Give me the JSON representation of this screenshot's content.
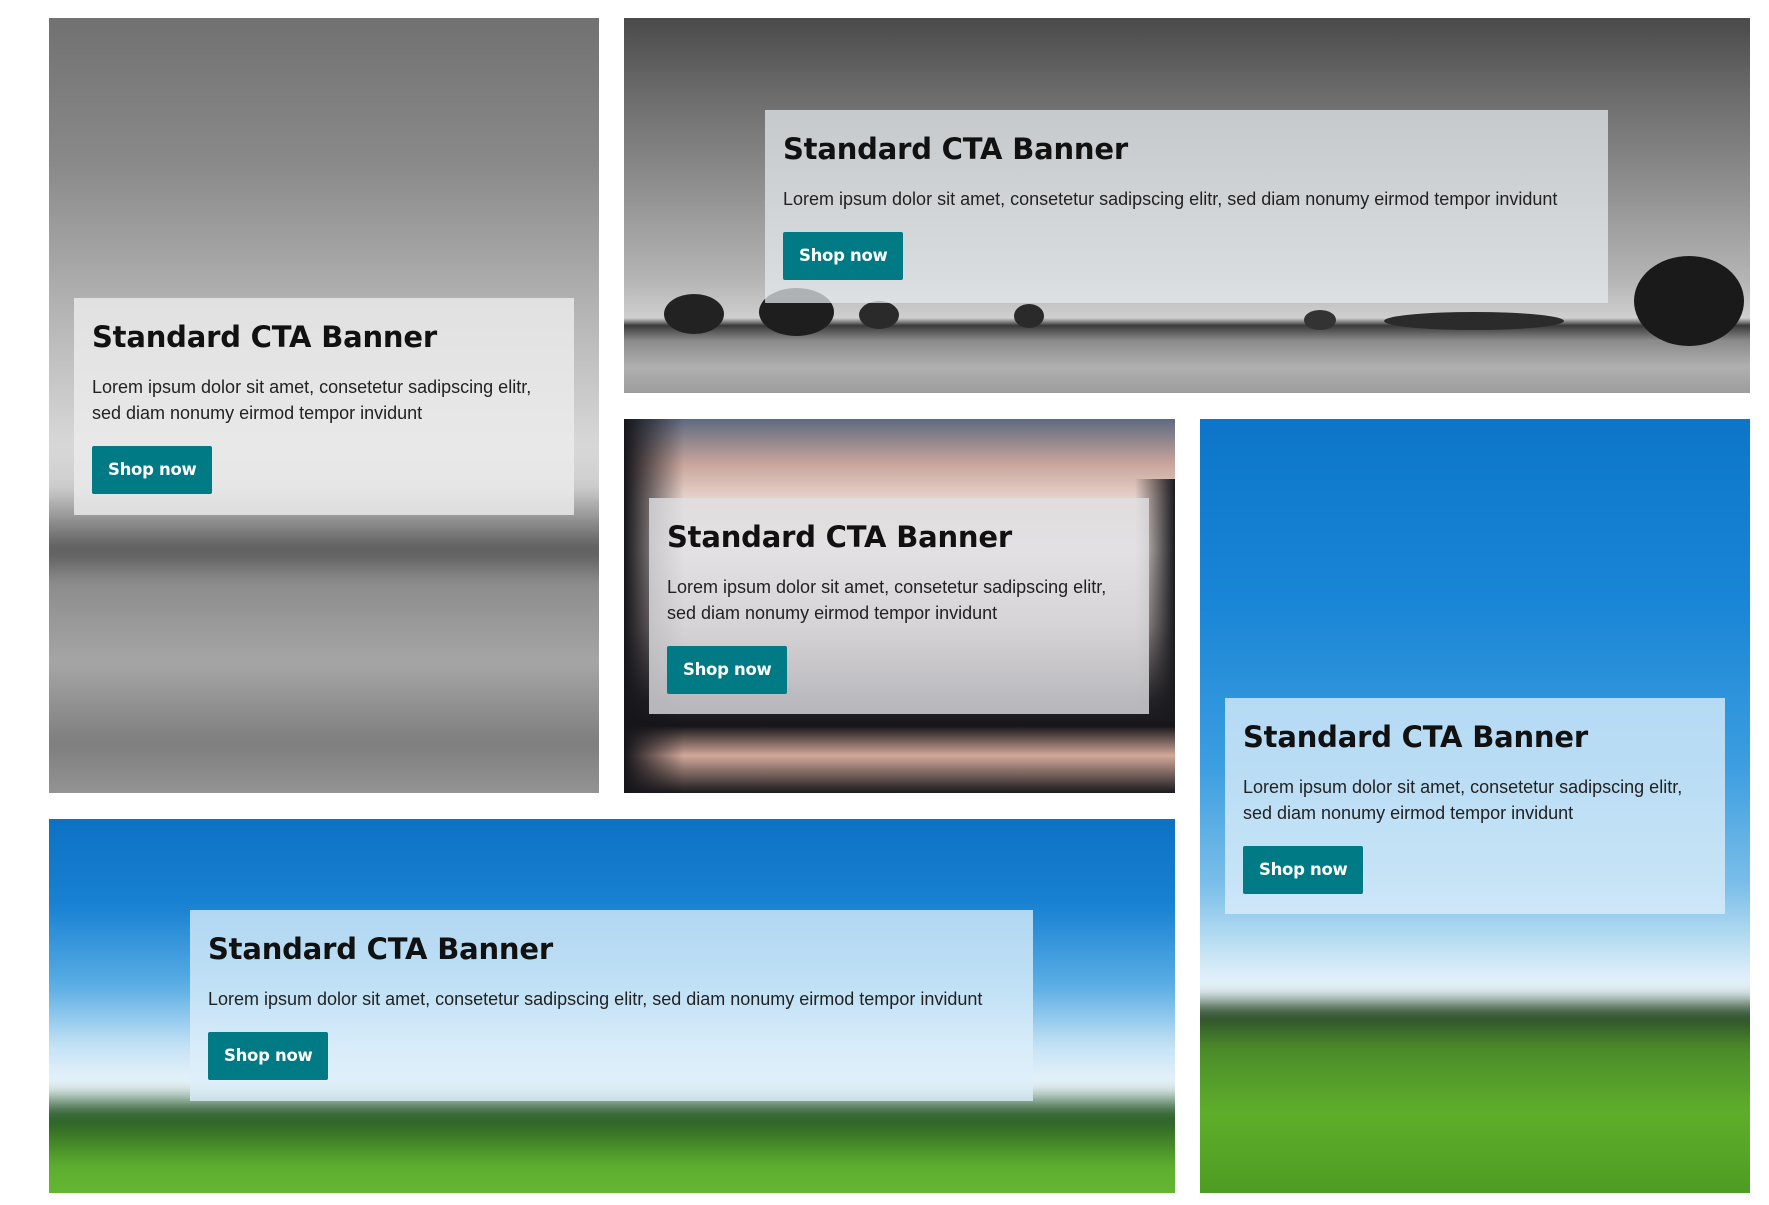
{
  "banners": [
    {
      "title": "Standard CTA Banner",
      "text": "Lorem ipsum dolor sit amet, consetetur sadipscing elitr, sed diam nonumy eirmod tempor invidunt",
      "button": "Shop now"
    },
    {
      "title": "Standard CTA Banner",
      "text": "Lorem ipsum dolor sit amet, consetetur sadipscing elitr, sed diam nonumy eirmod tempor invidunt",
      "button": "Shop now"
    },
    {
      "title": "Standard CTA Banner",
      "text": "Lorem ipsum dolor sit amet, consetetur sadipscing elitr, sed diam nonumy eirmod tempor invidunt",
      "button": "Shop now"
    },
    {
      "title": "Standard CTA Banner",
      "text": "Lorem ipsum dolor sit amet, consetetur sadipscing elitr, sed diam nonumy eirmod tempor invidunt",
      "button": "Shop now"
    },
    {
      "title": "Standard CTA Banner",
      "text": "Lorem ipsum dolor sit amet, consetetur sadipscing elitr, sed diam nonumy eirmod tempor invidunt",
      "button": "Shop now"
    }
  ],
  "colors": {
    "button": "#007a84",
    "button_text": "#ffffff",
    "title": "#111111",
    "body_text": "#222222"
  }
}
